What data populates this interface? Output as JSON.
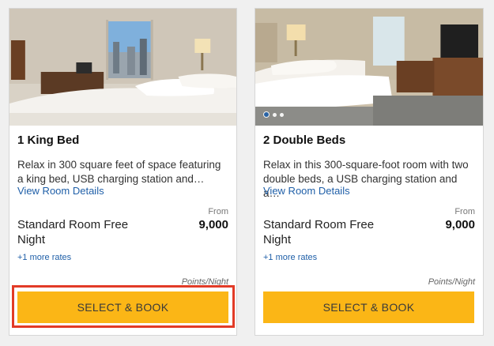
{
  "rooms": [
    {
      "title": "1 King Bed",
      "description": "Relax in 300 square feet of space featuring a king bed, USB charging station and…",
      "details_link": "View Room Details",
      "rate_name": "Standard Room Free Night",
      "from_label": "From",
      "points": "9,000",
      "more_rates": "+1 more rates",
      "unit": "Points/Night",
      "button_label": "SELECT & BOOK",
      "highlighted": true,
      "photo_dots": 0
    },
    {
      "title": "2 Double Beds",
      "description": "Relax in this 300-square-foot room with two double beds, a USB charging station and a…",
      "details_link": "View Room Details",
      "rate_name": "Standard Room Free Night",
      "from_label": "From",
      "points": "9,000",
      "more_rates": "+1 more rates",
      "unit": "Points/Night",
      "button_label": "SELECT & BOOK",
      "highlighted": false,
      "photo_dots": 3
    }
  ],
  "colors": {
    "button": "#fbb616",
    "link": "#1f5fa8",
    "highlight": "#e23b27"
  }
}
